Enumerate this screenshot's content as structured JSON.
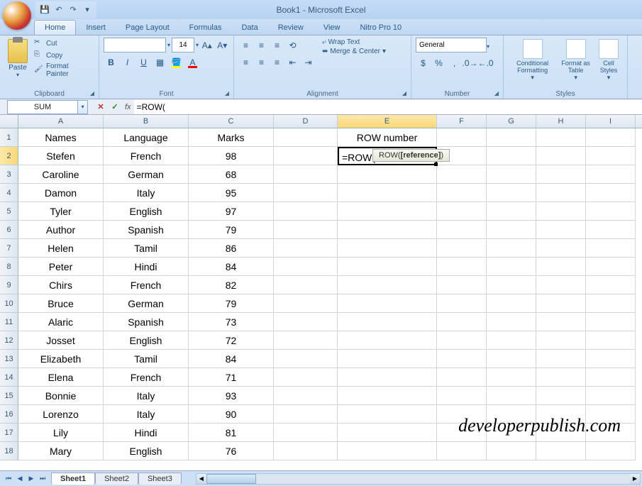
{
  "app": {
    "title": "Book1 - Microsoft Excel"
  },
  "qat": {
    "save": "💾",
    "undo": "↶",
    "redo": "↷"
  },
  "tabs": [
    "Home",
    "Insert",
    "Page Layout",
    "Formulas",
    "Data",
    "Review",
    "View",
    "Nitro Pro 10"
  ],
  "active_tab": "Home",
  "ribbon": {
    "clipboard": {
      "label": "Clipboard",
      "paste": "Paste",
      "cut": "Cut",
      "copy": "Copy",
      "fmtpaint": "Format Painter"
    },
    "font": {
      "label": "Font",
      "name": "",
      "size": "14"
    },
    "alignment": {
      "label": "Alignment",
      "wrap": "Wrap Text",
      "merge": "Merge & Center"
    },
    "number": {
      "label": "Number",
      "format": "General"
    },
    "styles": {
      "label": "Styles",
      "cond": "Conditional Formatting",
      "table": "Format as Table",
      "cell": "Cell Styles"
    }
  },
  "formula_bar": {
    "name_box": "SUM",
    "formula": "=ROW("
  },
  "columns": [
    {
      "letter": "A",
      "width": 120
    },
    {
      "letter": "B",
      "width": 120
    },
    {
      "letter": "C",
      "width": 120
    },
    {
      "letter": "D",
      "width": 90
    },
    {
      "letter": "E",
      "width": 140
    },
    {
      "letter": "F",
      "width": 70
    },
    {
      "letter": "G",
      "width": 70
    },
    {
      "letter": "H",
      "width": 70
    },
    {
      "letter": "I",
      "width": 70
    }
  ],
  "selected_col": "E",
  "selected_row": 2,
  "editing_cell": "=ROW(",
  "tooltip": {
    "func": "ROW",
    "args": "[reference]"
  },
  "rows": [
    {
      "n": 1,
      "A": "Names",
      "B": "Language",
      "C": "Marks",
      "E": "ROW number"
    },
    {
      "n": 2,
      "A": "Stefen",
      "B": "French",
      "C": "98",
      "E": "=ROW("
    },
    {
      "n": 3,
      "A": "Caroline",
      "B": "German",
      "C": "68"
    },
    {
      "n": 4,
      "A": "Damon",
      "B": "Italy",
      "C": "95"
    },
    {
      "n": 5,
      "A": "Tyler",
      "B": "English",
      "C": "97"
    },
    {
      "n": 6,
      "A": "Author",
      "B": "Spanish",
      "C": "79"
    },
    {
      "n": 7,
      "A": "Helen",
      "B": "Tamil",
      "C": "86"
    },
    {
      "n": 8,
      "A": "Peter",
      "B": "Hindi",
      "C": "84"
    },
    {
      "n": 9,
      "A": "Chirs",
      "B": "French",
      "C": "82"
    },
    {
      "n": 10,
      "A": "Bruce",
      "B": "German",
      "C": "79"
    },
    {
      "n": 11,
      "A": "Alaric",
      "B": "Spanish",
      "C": "73"
    },
    {
      "n": 12,
      "A": "Josset",
      "B": "English",
      "C": "72"
    },
    {
      "n": 13,
      "A": "Elizabeth",
      "B": "Tamil",
      "C": "84"
    },
    {
      "n": 14,
      "A": "Elena",
      "B": "French",
      "C": "71"
    },
    {
      "n": 15,
      "A": "Bonnie",
      "B": "Italy",
      "C": "93"
    },
    {
      "n": 16,
      "A": "Lorenzo",
      "B": "Italy",
      "C": "90"
    },
    {
      "n": 17,
      "A": "Lily",
      "B": "Hindi",
      "C": "81"
    },
    {
      "n": 18,
      "A": "Mary",
      "B": "English",
      "C": "76"
    }
  ],
  "sheets": [
    "Sheet1",
    "Sheet2",
    "Sheet3"
  ],
  "active_sheet": "Sheet1",
  "watermark": "developerpublish.com"
}
